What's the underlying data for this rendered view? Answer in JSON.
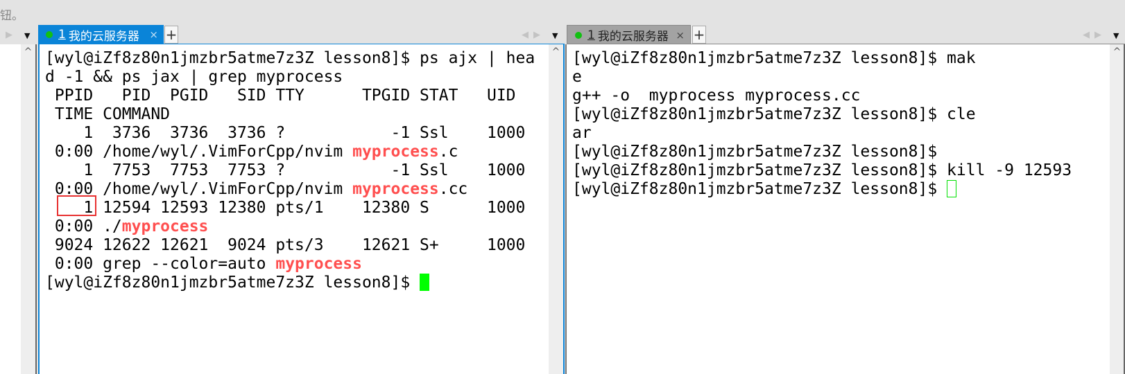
{
  "hint_text": "钮。",
  "left_panel": {
    "tab": {
      "number": "1",
      "title": "我的云服务器",
      "close": "×",
      "status_color": "#12c012",
      "active": true
    },
    "new_tab": "+",
    "lines": [
      [
        {
          "t": "[wyl@iZf8z80n1jmzbr5atme7z3Z lesson8]$ ps ajx | hea"
        }
      ],
      [
        {
          "t": "d -1 && ps jax | grep myprocess"
        }
      ],
      [
        {
          "t": " PPID   PID  PGID   SID TTY      TPGID STAT   UID"
        }
      ],
      [
        {
          "t": " TIME COMMAND"
        }
      ],
      [
        {
          "t": "    1  3736  3736  3736 ?           -1 Ssl    1000"
        }
      ],
      [
        {
          "t": " 0:00 /home/wyl/.VimForCpp/nvim "
        },
        {
          "t": "myprocess",
          "hl": true
        },
        {
          "t": ".c"
        }
      ],
      [
        {
          "t": "    1  7753  7753  7753 ?           -1 Ssl    1000"
        }
      ],
      [
        {
          "t": " 0:00 /home/wyl/.VimForCpp/nvim "
        },
        {
          "t": "myprocess",
          "hl": true
        },
        {
          "t": ".cc"
        }
      ],
      [
        {
          "t": "    1 12594 12593 12380 pts/1    12380 S      1000"
        }
      ],
      [
        {
          "t": " 0:00 ./"
        },
        {
          "t": "myprocess",
          "hl": true
        }
      ],
      [
        {
          "t": " 9024 12622 12621  9024 pts/3    12621 S+     1000"
        }
      ],
      [
        {
          "t": " 0:00 grep --color=auto "
        },
        {
          "t": "myprocess",
          "hl": true
        }
      ],
      [
        {
          "t": "[wyl@iZf8z80n1jmzbr5atme7z3Z lesson8]$ "
        },
        {
          "cursor": "solid"
        }
      ]
    ]
  },
  "right_panel": {
    "tab": {
      "number": "1",
      "title": "我的云服务器",
      "close": "×",
      "status_color": "#12c012",
      "active": false
    },
    "new_tab": "+",
    "lines": [
      [
        {
          "t": "[wyl@iZf8z80n1jmzbr5atme7z3Z lesson8]$ mak"
        }
      ],
      [
        {
          "t": "e"
        }
      ],
      [
        {
          "t": "g++ -o  myprocess myprocess.cc"
        }
      ],
      [
        {
          "t": "[wyl@iZf8z80n1jmzbr5atme7z3Z lesson8]$ cle"
        }
      ],
      [
        {
          "t": "ar"
        }
      ],
      [
        {
          "t": "[wyl@iZf8z80n1jmzbr5atme7z3Z lesson8]$"
        }
      ],
      [
        {
          "t": "[wyl@iZf8z80n1jmzbr5atme7z3Z lesson8]$ kill -9 12593"
        }
      ],
      [
        {
          "t": "[wyl@iZf8z80n1jmzbr5atme7z3Z lesson8]$ "
        },
        {
          "cursor": "hollow"
        }
      ]
    ]
  },
  "colors": {
    "highlight": "#ff4f4f",
    "cursor": "#00ff00",
    "tab_active": "#0a84d8",
    "annotation_box": "#e83030"
  }
}
